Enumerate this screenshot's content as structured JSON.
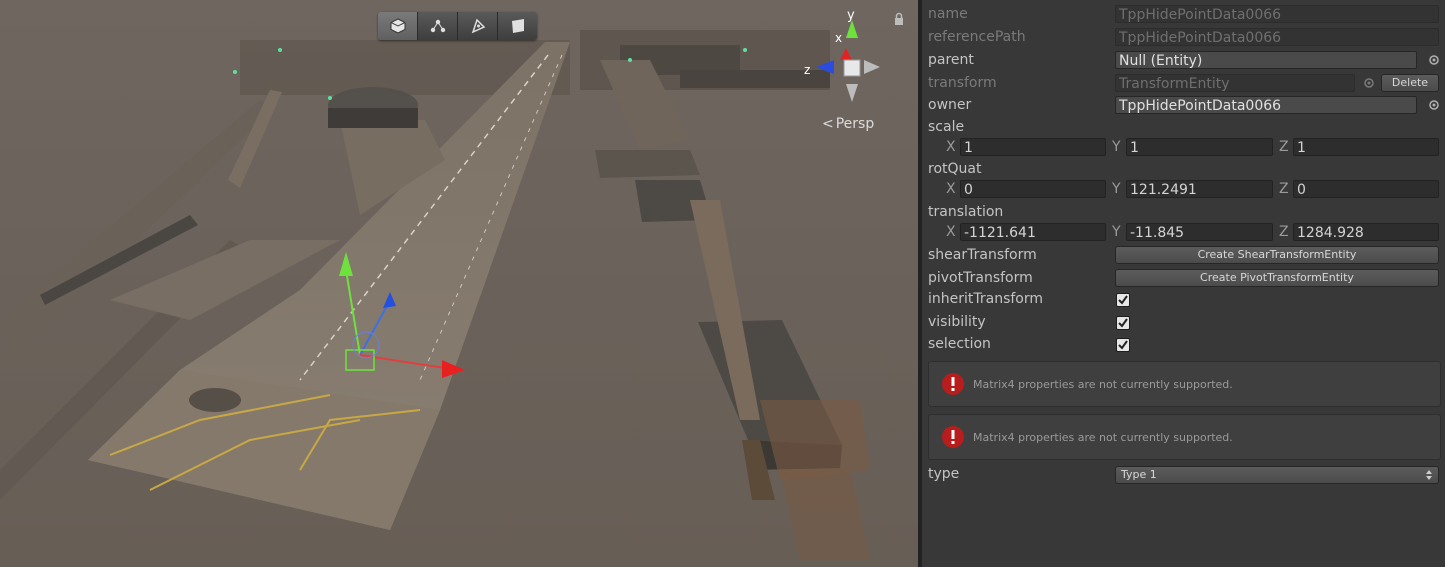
{
  "scene": {
    "tools": [
      {
        "name": "shaded-mode-icon",
        "active": true
      },
      {
        "name": "wireframe-mode-icon",
        "active": false
      },
      {
        "name": "lighting-mode-icon",
        "active": false
      },
      {
        "name": "2d-mode-icon",
        "active": false
      }
    ],
    "persp_label": "Persp",
    "axis_labels": {
      "x": "x",
      "y": "y",
      "z": "z"
    }
  },
  "inspector": {
    "name": {
      "label": "name",
      "value": "TppHidePointData0066"
    },
    "referencePath": {
      "label": "referencePath",
      "value": "TppHidePointData0066"
    },
    "parent": {
      "label": "parent",
      "value": "Null (Entity)"
    },
    "transform": {
      "label": "transform",
      "value": "TransformEntity",
      "delete_label": "Delete"
    },
    "owner": {
      "label": "owner",
      "value": "TppHidePointData0066"
    },
    "scale": {
      "label": "scale",
      "x": "1",
      "y": "1",
      "z": "1"
    },
    "rotQuat": {
      "label": "rotQuat",
      "x": "0",
      "y": "121.2491",
      "z": "0"
    },
    "translation": {
      "label": "translation",
      "x": "-1121.641",
      "y": "-11.845",
      "z": "1284.928"
    },
    "axis": {
      "x": "X",
      "y": "Y",
      "z": "Z"
    },
    "shearTransform": {
      "label": "shearTransform",
      "button": "Create ShearTransformEntity"
    },
    "pivotTransform": {
      "label": "pivotTransform",
      "button": "Create PivotTransformEntity"
    },
    "inheritTransform": {
      "label": "inheritTransform",
      "checked": true
    },
    "visibility": {
      "label": "visibility",
      "checked": true
    },
    "selection": {
      "label": "selection",
      "checked": true
    },
    "help1": "Matrix4 properties are not currently supported.",
    "help2": "Matrix4 properties are not currently supported.",
    "type": {
      "label": "type",
      "value": "Type 1"
    }
  }
}
